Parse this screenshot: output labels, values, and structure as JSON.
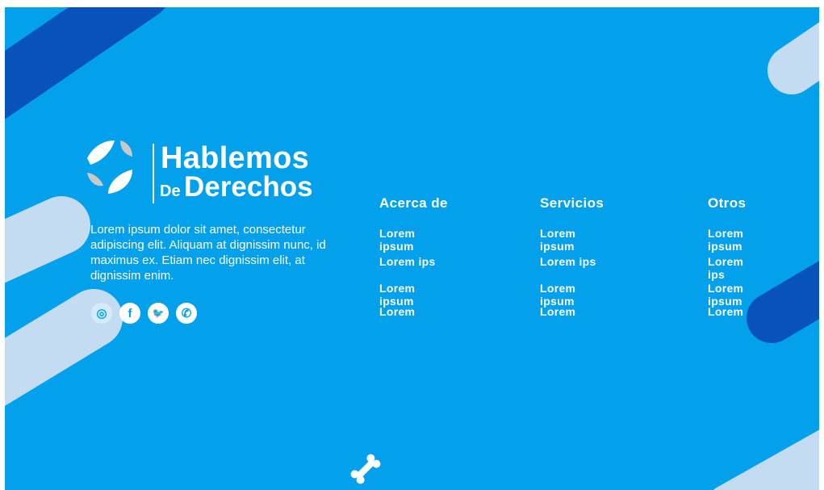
{
  "brand": {
    "title": "Hablemos",
    "sub_small": "De",
    "sub_large": "Derechos"
  },
  "about": {
    "text": "Lorem ipsum dolor sit amet, consectetur adipiscing elit. Aliquam at dignissim nunc, id maximus ex. Etiam nec dignissim elit, at dignissim enim."
  },
  "social": [
    {
      "icon": "instagram-icon",
      "glyph": "◎"
    },
    {
      "icon": "facebook-icon",
      "glyph": "f"
    },
    {
      "icon": "twitter-icon",
      "glyph": "🐦"
    },
    {
      "icon": "whatsapp-icon",
      "glyph": "✆"
    }
  ],
  "columns": [
    {
      "heading": "Acerca de",
      "links": [
        "Lorem ipsum",
        "Lorem ips",
        "Lorem ipsum",
        "Lorem"
      ]
    },
    {
      "heading": "Servicios",
      "links": [
        "Lorem ipsum",
        "Lorem ips",
        "Lorem ipsum",
        "Lorem"
      ]
    },
    {
      "heading": "Otros",
      "links": [
        "Lorem ipsum",
        "Lorem ips",
        "Lorem ipsum",
        "Lorem"
      ]
    }
  ],
  "colors": {
    "background": "#03a1ec",
    "pale": "#c4dcf1",
    "dark": "#0752bb"
  }
}
